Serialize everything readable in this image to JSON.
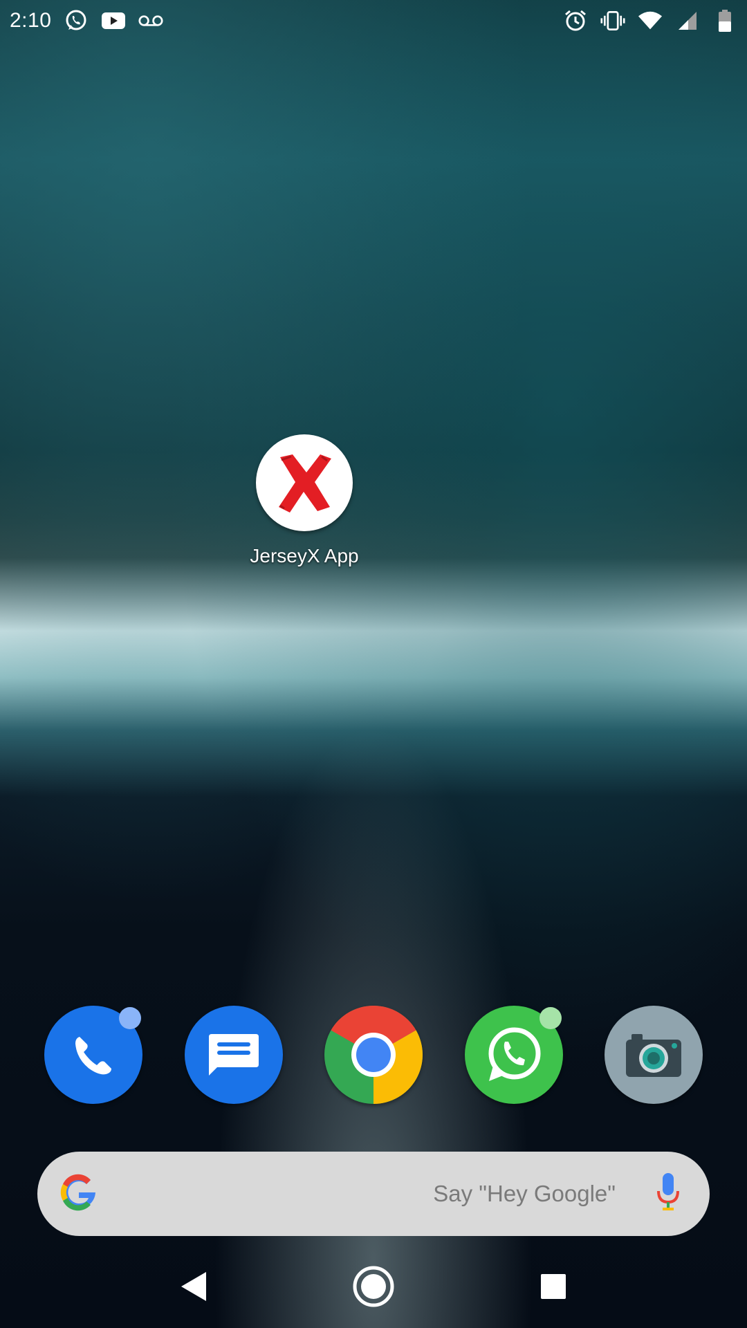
{
  "status_bar": {
    "time": "2:10",
    "notification_icons": [
      "whatsapp-icon",
      "youtube-icon",
      "voicemail-icon"
    ],
    "system_icons": [
      "alarm-icon",
      "vibrate-icon",
      "wifi-icon",
      "signal-icon",
      "battery-icon"
    ]
  },
  "desktop": {
    "apps": [
      {
        "label": "JerseyX App",
        "icon": "red-x-icon",
        "icon_bg": "#ffffff",
        "icon_color": "#e31e24"
      }
    ]
  },
  "dock": {
    "apps": [
      {
        "name": "Phone",
        "icon": "phone-icon",
        "bg": "#1a73e8",
        "badge": "#8ab4f8"
      },
      {
        "name": "Messages",
        "icon": "messages-icon",
        "bg": "#1a73e8"
      },
      {
        "name": "Chrome",
        "icon": "chrome-icon"
      },
      {
        "name": "WhatsApp",
        "icon": "whatsapp-icon",
        "bg": "#3ec24c",
        "badge": "#a6e3a8"
      },
      {
        "name": "Camera",
        "icon": "camera-icon",
        "bg": "#90a4ae"
      }
    ]
  },
  "search": {
    "placeholder": "Say \"Hey Google\"",
    "left_icon": "google-g-icon",
    "right_icon": "mic-icon"
  },
  "nav": {
    "buttons": [
      "back-icon",
      "home-icon",
      "recents-icon"
    ]
  }
}
